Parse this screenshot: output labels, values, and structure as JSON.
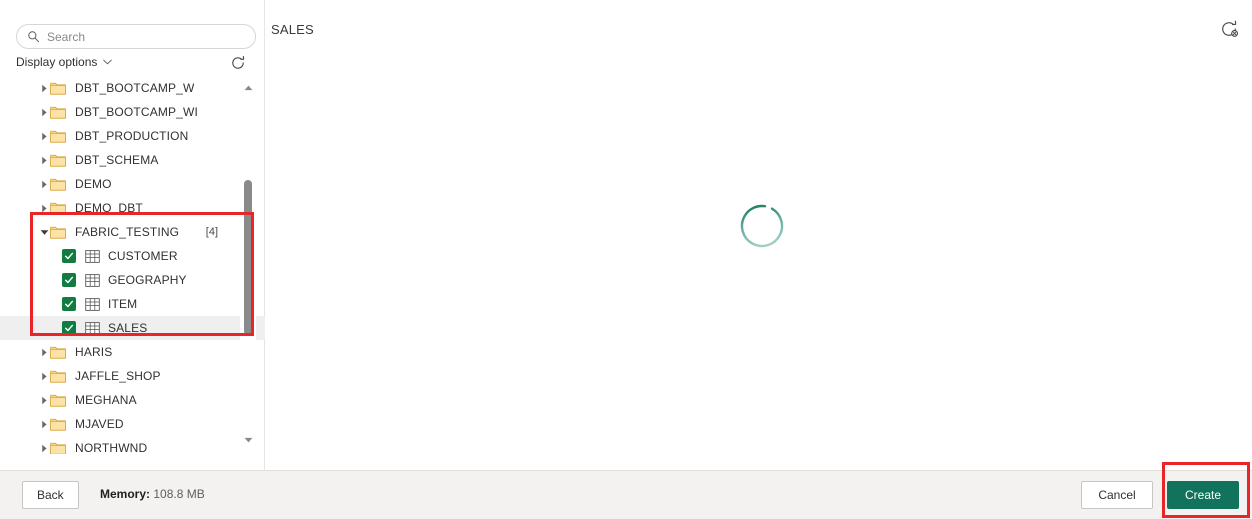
{
  "search": {
    "placeholder": "Search",
    "value": "",
    "icon": "search-icon"
  },
  "display_options": {
    "label": "Display options",
    "chevron_icon": "chevron-down-icon",
    "refresh_icon": "refresh-icon"
  },
  "tree": {
    "items": [
      {
        "label": "DBT_BOOTCAMP_W",
        "type": "folder",
        "expanded": false,
        "indent": 0,
        "count": ""
      },
      {
        "label": "DBT_BOOTCAMP_WI",
        "type": "folder",
        "expanded": false,
        "indent": 0,
        "count": ""
      },
      {
        "label": "DBT_PRODUCTION",
        "type": "folder",
        "expanded": false,
        "indent": 0,
        "count": ""
      },
      {
        "label": "DBT_SCHEMA",
        "type": "folder",
        "expanded": false,
        "indent": 0,
        "count": ""
      },
      {
        "label": "DEMO",
        "type": "folder",
        "expanded": false,
        "indent": 0,
        "count": ""
      },
      {
        "label": "DEMO_DBT",
        "type": "folder",
        "expanded": false,
        "indent": 0,
        "count": ""
      },
      {
        "label": "FABRIC_TESTING",
        "type": "folder",
        "expanded": true,
        "indent": 0,
        "count": "[4]"
      },
      {
        "label": "CUSTOMER",
        "type": "table",
        "checked": true,
        "indent": 1,
        "selected": false
      },
      {
        "label": "GEOGRAPHY",
        "type": "table",
        "checked": true,
        "indent": 1,
        "selected": false
      },
      {
        "label": "ITEM",
        "type": "table",
        "checked": true,
        "indent": 1,
        "selected": false
      },
      {
        "label": "SALES",
        "type": "table",
        "checked": true,
        "indent": 1,
        "selected": true
      },
      {
        "label": "HARIS",
        "type": "folder",
        "expanded": false,
        "indent": 0,
        "count": ""
      },
      {
        "label": "JAFFLE_SHOP",
        "type": "folder",
        "expanded": false,
        "indent": 0,
        "count": ""
      },
      {
        "label": "MEGHANA",
        "type": "folder",
        "expanded": false,
        "indent": 0,
        "count": ""
      },
      {
        "label": "MJAVED",
        "type": "folder",
        "expanded": false,
        "indent": 0,
        "count": ""
      },
      {
        "label": "NORTHWND",
        "type": "folder",
        "expanded": false,
        "indent": 0,
        "count": ""
      }
    ],
    "scrollbar": {
      "up_icon": "scroll-up-arrow-icon",
      "down_icon": "scroll-down-arrow-icon"
    }
  },
  "preview": {
    "title": "SALES",
    "refresh_icon": "refresh-preview-icon",
    "loading": true,
    "spinner_icon": "loading-spinner-icon"
  },
  "footer": {
    "back_label": "Back",
    "memory_label": "Memory:",
    "memory_value": "108.8 MB",
    "cancel_label": "Cancel",
    "create_label": "Create"
  },
  "colors": {
    "primary": "#11735b",
    "checkbox_green": "#107c41",
    "folder_yellow": "#f9d88b",
    "annotation_red": "#e8262a",
    "selection_gray": "#efefef",
    "footer_bg": "#f3f2f1"
  },
  "annotations": [
    {
      "name": "fabric-testing-highlight",
      "target": "tree-group-fabric-testing"
    },
    {
      "name": "create-button-highlight",
      "target": "create-button"
    }
  ]
}
